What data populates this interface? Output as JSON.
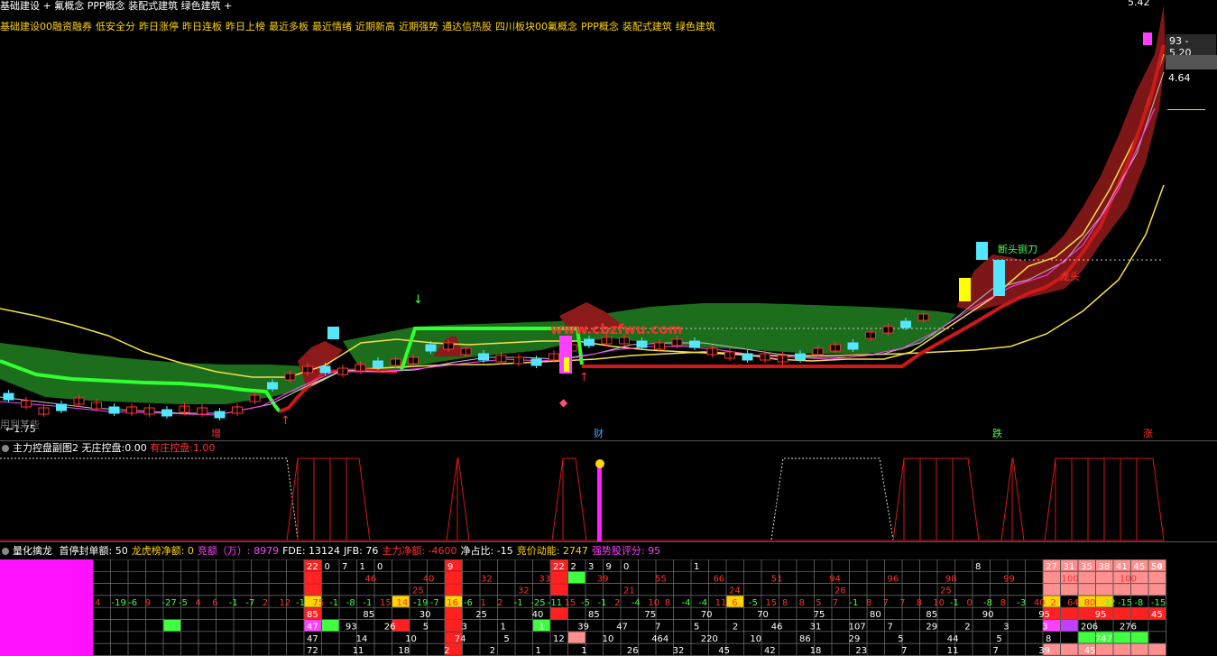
{
  "header": {
    "title_line": "基础建设 + 氟概念 PPP概念 装配式建筑 绿色建筑 +",
    "concepts": [
      "基础建设00融资融券",
      "低安全分",
      "昨日涨停",
      "昨日连板",
      "昨日上榜",
      "最近多板",
      "最近情绪",
      "近期新高",
      "近期强势",
      "通达信热股",
      "四川板块00氟概念",
      "PPP概念",
      "装配式建筑",
      "绿色建筑"
    ]
  },
  "price_scale": {
    "top": "5.42",
    "tag1": "93 - 5.20",
    "tag2": "4.64",
    "low": "←1.75",
    "note": "用到某些"
  },
  "main_chart": {
    "watermark": "www.cbzfwu.com",
    "annotations": [
      {
        "text": "断头铡刀",
        "color": "#40ff40"
      },
      {
        "text": "龙头",
        "color": "#ff3030"
      }
    ],
    "bottom_markers": [
      {
        "text": "增",
        "color": "#ff3030"
      },
      {
        "text": "财",
        "color": "#40a0ff"
      },
      {
        "text": "跌",
        "color": "#40ff40"
      },
      {
        "text": "涨",
        "color": "#ff3030"
      }
    ]
  },
  "panel2": {
    "name": "主力控盘副图2",
    "label1": "无庄控盘:",
    "value1": "0.00",
    "label2": "有庄控盘:",
    "value2": "1.00"
  },
  "panel3": {
    "name": "量化擒龙",
    "items": [
      {
        "label": "首停封单额:",
        "value": "50",
        "color": "#ffffff"
      },
      {
        "label": "龙虎榜净额:",
        "value": "0",
        "color": "#ffd400"
      },
      {
        "label": "竞额（万）:",
        "value": "8979",
        "color": "#ff40ff"
      },
      {
        "label": "FDE:",
        "value": "13124",
        "color": "#ffffff"
      },
      {
        "label": "JFB:",
        "value": "76",
        "color": "#ffffff"
      },
      {
        "label": "主力净额:",
        "value": "-4600",
        "color": "#ff3030"
      },
      {
        "label": "净占比:",
        "value": "-15",
        "color": "#ffffff"
      },
      {
        "label": "竞价动能:",
        "value": "2747",
        "color": "#ffd400"
      },
      {
        "label": "强势股评分:",
        "value": "95",
        "color": "#ff40ff"
      }
    ],
    "row_top": [
      "22",
      "0",
      "7",
      "1",
      "0",
      "9",
      "22",
      "2",
      "3",
      "9",
      "0",
      "1",
      "8",
      "27",
      "31",
      "35",
      "38",
      "41",
      "45",
      "50",
      "54"
    ],
    "row2": [
      "47",
      "46",
      "40",
      "32",
      "33",
      "39",
      "55",
      "66",
      "51",
      "94",
      "96",
      "98",
      "99",
      "100",
      "100",
      "100",
      "100"
    ],
    "row3": [
      "20",
      "25",
      "32",
      "21",
      "24",
      "26",
      "25"
    ],
    "row_mid": [
      "4",
      "-19",
      "-6",
      "9",
      "-27",
      "-5",
      "4",
      "6",
      "-1",
      "-7",
      "2",
      "12",
      "-1",
      "75",
      "-1",
      "-8",
      "-1",
      "15",
      "14",
      "-19",
      "-7",
      "16",
      "-6",
      "1",
      "2",
      "-1",
      "-25",
      "-11",
      "15",
      "-5",
      "-1",
      "2",
      "-4",
      "10",
      "8",
      "-4",
      "-4",
      "11",
      "6",
      "-5",
      "15",
      "8",
      "8",
      "5",
      "7",
      "-1",
      "8",
      "7",
      "7",
      "8",
      "10",
      "-1",
      "0",
      "-8",
      "8",
      "-3",
      "40",
      "2",
      "64",
      "80",
      "-32",
      "-15",
      "-8",
      "-15"
    ],
    "row5": [
      "85",
      "85",
      "30",
      "25",
      "40",
      "85",
      "75",
      "70",
      "70",
      "75",
      "80",
      "85",
      "90",
      "95",
      "95",
      "45"
    ],
    "row6": [
      "47",
      "93",
      "26",
      "5",
      "3",
      "1",
      "1",
      "39",
      "47",
      "7",
      "5",
      "2",
      "46",
      "31",
      "107",
      "7",
      "29",
      "2",
      "3",
      "3",
      "206",
      "276"
    ],
    "row7": [
      "47",
      "14",
      "10",
      "74",
      "5",
      "12",
      "10",
      "464",
      "220",
      "10",
      "86",
      "29",
      "5",
      "44",
      "5",
      "8",
      "747"
    ],
    "row8": [
      "72",
      "11",
      "18",
      "2",
      "2",
      "1",
      "1",
      "26",
      "32",
      "45",
      "42",
      "18",
      "23",
      "7",
      "11",
      "7",
      "39",
      "45"
    ]
  }
}
